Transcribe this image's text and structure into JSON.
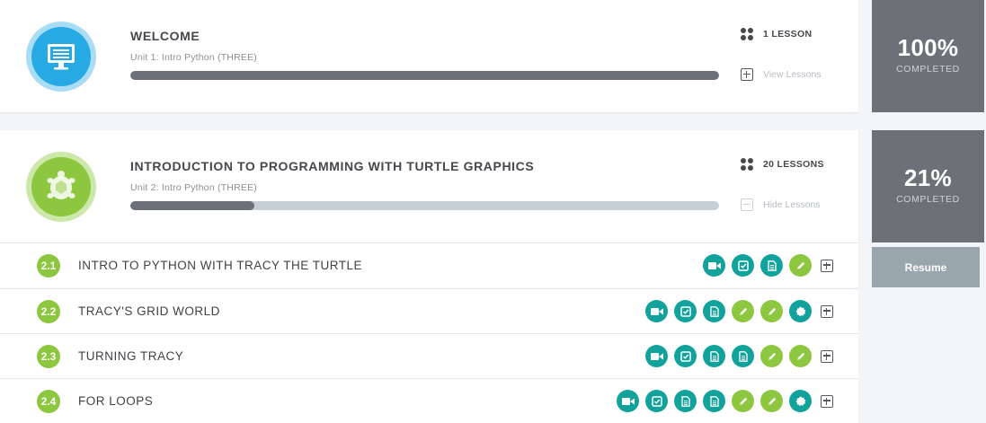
{
  "units": [
    {
      "title": "WELCOME",
      "subtitle": "Unit 1: Intro Python (THREE)",
      "lessons_count": "1 LESSON",
      "toggle_label": "View Lessons",
      "progress": 1.0,
      "percent": "100%",
      "completed_label": "COMPLETED",
      "icon": "monitor-icon"
    },
    {
      "title": "INTRODUCTION TO PROGRAMMING WITH TURTLE GRAPHICS",
      "subtitle": "Unit 2: Intro Python (THREE)",
      "lessons_count": "20 LESSONS",
      "toggle_label": "Hide Lessons",
      "progress": 0.21,
      "percent": "21%",
      "completed_label": "COMPLETED",
      "icon": "turtle-icon"
    }
  ],
  "resume_label": "Resume",
  "lessons": [
    {
      "number": "2.1",
      "title": "INTRO TO PYTHON WITH TRACY THE TURTLE",
      "activities": [
        "video",
        "check",
        "doc",
        "pencil"
      ]
    },
    {
      "number": "2.2",
      "title": "TRACY'S GRID WORLD",
      "activities": [
        "video",
        "check",
        "doc",
        "pencil",
        "pencil",
        "badge"
      ]
    },
    {
      "number": "2.3",
      "title": "TURNING TRACY",
      "activities": [
        "video",
        "check",
        "doc",
        "doc",
        "pencil",
        "pencil"
      ]
    },
    {
      "number": "2.4",
      "title": "FOR LOOPS",
      "activities": [
        "video",
        "check",
        "doc",
        "doc",
        "pencil",
        "pencil",
        "badge"
      ]
    }
  ],
  "colors": {
    "teal": "#11a29b",
    "green": "#8dc63f",
    "blue": "#27a9e3",
    "stat_bg": "#6c7178",
    "resume_bg": "#9aa6ae"
  }
}
